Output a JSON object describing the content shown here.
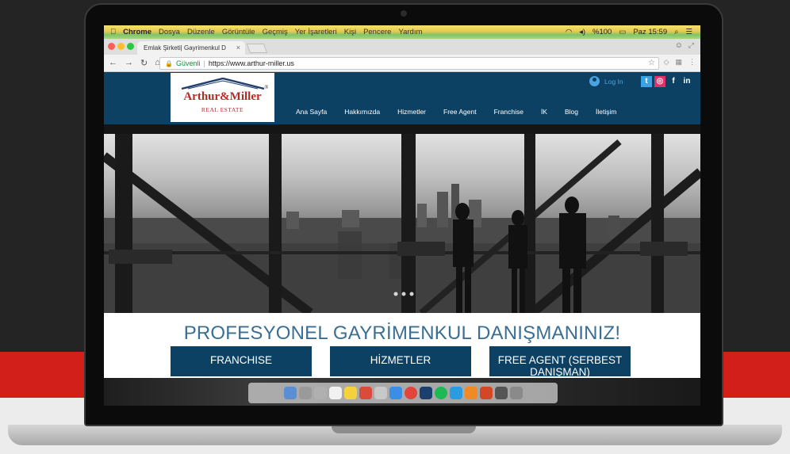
{
  "menubar": {
    "apple": "",
    "app": "Chrome",
    "menus": [
      "Dosya",
      "Düzenle",
      "Görüntüle",
      "Geçmiş",
      "Yer İşaretleri",
      "Kişi",
      "Pencere",
      "Yardım"
    ],
    "battery": "%100",
    "clock": "Paz 15:59"
  },
  "browser": {
    "tab_title": "Emlak Şirketi| Gayrimenkul D",
    "security_label": "Güvenli",
    "url": "https://www.arthur-miller.us"
  },
  "site": {
    "logo": {
      "name": "Arthur&Miller",
      "subtitle": "REAL ESTATE",
      "reg": "®"
    },
    "nav": [
      "Ana Sayfa",
      "Hakkımızda",
      "Hizmetler",
      "Free Agent",
      "Franchise",
      "İK",
      "Blog",
      "İletişim"
    ],
    "login_label": "Log In",
    "social": [
      "twitter-icon",
      "instagram-icon",
      "facebook-icon",
      "linkedin-icon"
    ],
    "tagline": "PROFESYONEL GAYRİMENKUL DANIŞMANINIZ!",
    "cta": {
      "franchise": "FRANCHISE",
      "services": "HİZMETLER",
      "free_agent": "FREE AGENT (SERBEST DANIŞMAN)"
    }
  },
  "colors": {
    "header_blue": "#0d4163",
    "logo_red": "#b52a25",
    "accent_red": "#d21f1a",
    "tagline_blue": "#3a6f93"
  }
}
